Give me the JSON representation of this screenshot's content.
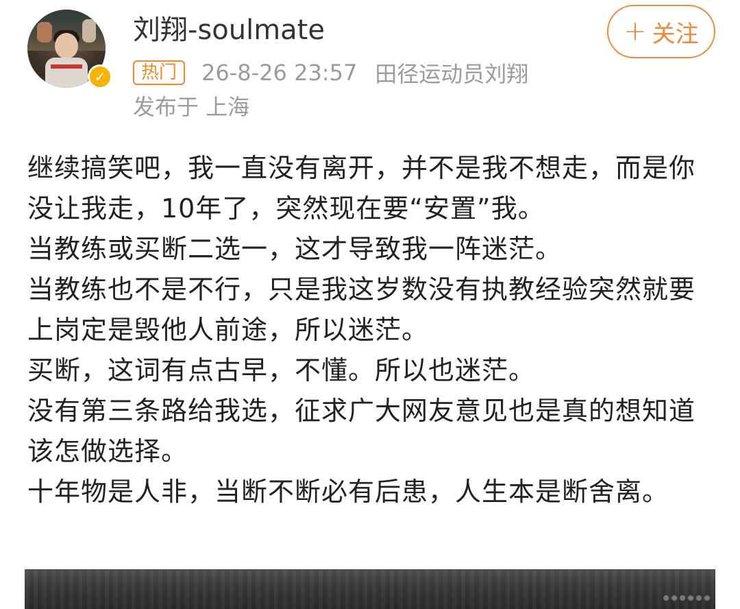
{
  "post": {
    "author": {
      "name": "刘翔-soulmate",
      "avatar_icon": "user-avatar-photo",
      "verified_icon": "verified-badge-icon",
      "verified_color": "#f6b400"
    },
    "follow_button": {
      "icon": "plus-icon",
      "plus": "+",
      "label": "关注",
      "color": "#f0893b"
    },
    "meta": {
      "hot_tag": "热门",
      "hot_tag_color": "#ea8a2e",
      "time": "26-8-26 23:57",
      "source": "田径运动员刘翔",
      "location": "发布于 上海"
    },
    "paragraphs": [
      "继续搞笑吧，我一直没有离开，并不是我不想走，而是你没让我走，10年了，突然现在要“安置”我。",
      "当教练或买断二选一，这才导致我一阵迷茫。",
      "当教练也不是不行，只是我这岁数没有执教经验突然就要上岗定是毁他人前途，所以迷茫。",
      "买断，这词有点古早，不懂。所以也迷茫。",
      "没有第三条路给我选，征求广大网友意见也是真的想知道该怎做选择。",
      "十年物是人非，当断不断必有后患，人生本是断舍离。"
    ]
  }
}
